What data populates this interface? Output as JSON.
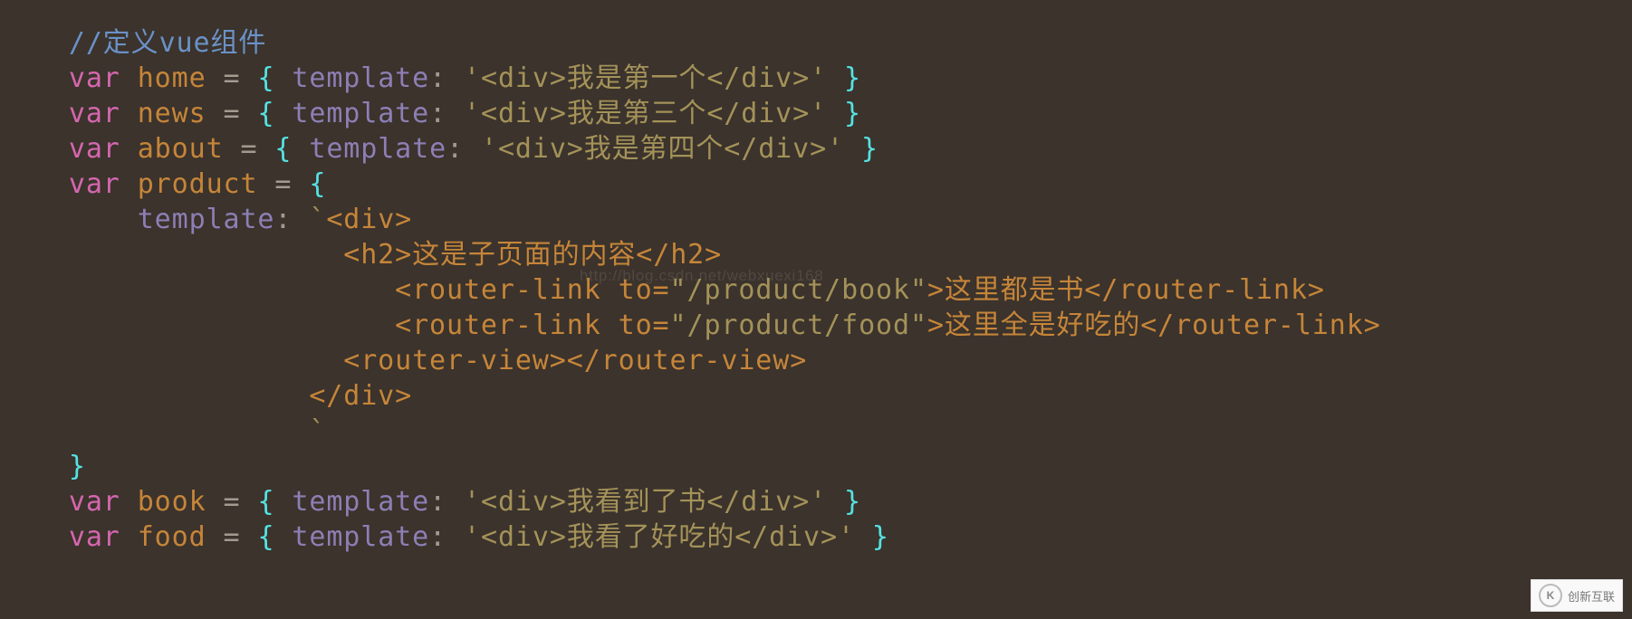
{
  "theme": {
    "background": "#3b332c",
    "comment": "#6b91c7",
    "keyword": "#d666af",
    "identifier": "#c68539",
    "brace": "#55e2e2",
    "property": "#8d7fb5",
    "string": "#a49259",
    "punct": "#a39a90"
  },
  "tokens": {
    "kw_var": "var",
    "eq": " = ",
    "colon_sp": ": ",
    "brace_open": "{ ",
    "brace_open_bare": "{",
    "brace_close": " }",
    "brace_close_bare": "}",
    "key_template": "template",
    "backtick": "`"
  },
  "code": {
    "comment": "//定义vue组件",
    "home": {
      "name": "home",
      "template_str": "'<div>我是第一个</div>'"
    },
    "news": {
      "name": "news",
      "template_str": "'<div>我是第三个</div>'"
    },
    "about": {
      "name": "about",
      "template_str": "'<div>我是第四个</div>'"
    },
    "product": {
      "name": "product",
      "tpl": {
        "open_div": "<div>",
        "h2": "<h2>这是子页面的内容</h2>",
        "link1_open": "<router-link to=",
        "link1_to": "\"/product/book\"",
        "link1_rest": ">这里都是书</router-link>",
        "link2_open": "<router-link to=",
        "link2_to": "\"/product/food\"",
        "link2_rest": ">这里全是好吃的</router-link>",
        "router_view": "<router-view></router-view>",
        "close_div": "</div>"
      }
    },
    "book": {
      "name": "book",
      "template_str": "'<div>我看到了书</div>'"
    },
    "food": {
      "name": "food",
      "template_str": "'<div>我看了好吃的</div>'"
    }
  },
  "watermark": {
    "faint": "http://blog.csdn.net/webxuexi168",
    "badge_icon": "K",
    "badge_text": "创新互联"
  }
}
